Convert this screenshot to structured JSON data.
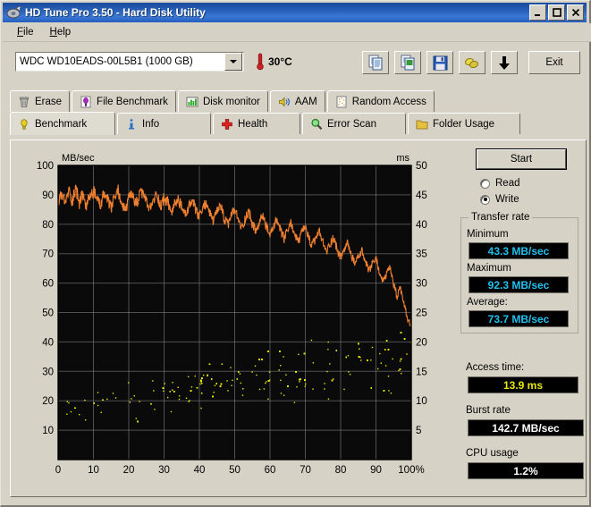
{
  "window": {
    "title": "HD Tune Pro 3.50 - Hard Disk Utility",
    "icon": "hdtune-icon",
    "minimize": "_",
    "maximize": "□",
    "close": "✕"
  },
  "menu": [
    {
      "label": "File",
      "accel": "F"
    },
    {
      "label": "Help",
      "accel": "H"
    }
  ],
  "toolbar": {
    "drive": "WDC WD10EADS-00L5B1 (1000 GB)",
    "temperature": "30°C",
    "buttons": [
      {
        "name": "copy-button",
        "icon": "copy-icon"
      },
      {
        "name": "copy-image-button",
        "icon": "copy-image-icon"
      },
      {
        "name": "save-button",
        "icon": "floppy-disk-icon"
      },
      {
        "name": "settings-button",
        "icon": "options-icon"
      },
      {
        "name": "download-button",
        "icon": "down-arrow-icon"
      }
    ],
    "exit_label": "Exit"
  },
  "tabs": {
    "back_row": [
      {
        "label": "Erase",
        "icon": "trash-icon"
      },
      {
        "label": "File Benchmark",
        "icon": "file-benchmark-icon"
      },
      {
        "label": "Disk monitor",
        "icon": "disk-monitor-icon"
      },
      {
        "label": "AAM",
        "icon": "speaker-icon"
      },
      {
        "label": "Random Access",
        "icon": "random-access-icon"
      }
    ],
    "front_row": [
      {
        "label": "Benchmark",
        "icon": "bulb-icon",
        "active": true
      },
      {
        "label": "Info",
        "icon": "info-icon",
        "active": false
      },
      {
        "label": "Health",
        "icon": "health-cross-icon",
        "active": false
      },
      {
        "label": "Error Scan",
        "icon": "magnifier-icon",
        "active": false
      },
      {
        "label": "Folder Usage",
        "icon": "folder-icon",
        "active": false
      }
    ]
  },
  "controls": {
    "start_label": "Start",
    "mode_read": "Read",
    "mode_write": "Write",
    "selected_mode": "Write"
  },
  "results": {
    "transfer_rate_group": "Transfer rate",
    "minimum_label": "Minimum",
    "minimum_value": "43.3 MB/sec",
    "maximum_label": "Maximum",
    "maximum_value": "92.3 MB/sec",
    "average_label": "Average:",
    "average_value": "73.7 MB/sec",
    "access_time_label": "Access time:",
    "access_time_value": "13.9 ms",
    "burst_rate_label": "Burst rate",
    "burst_rate_value": "142.7 MB/sec",
    "cpu_usage_label": "CPU usage",
    "cpu_usage_value": "1.2%"
  },
  "colors": {
    "transfer_curve": "#f08030",
    "access_dots": "#e8e800",
    "grid": "#8a8a8a",
    "plot_bg": "#0a0a0a",
    "lcd_cyan": "#22c0ee",
    "lcd_yellow": "#e8e800",
    "titlebar": "#2a63bd"
  },
  "chart_data": {
    "type": "line",
    "title": "",
    "xlabel": "",
    "ylabel": "MB/sec",
    "y2label": "ms",
    "xlim": [
      0,
      100
    ],
    "ylim": [
      0,
      100
    ],
    "y2lim": [
      0,
      50
    ],
    "grid": true,
    "xticks": [
      0,
      10,
      20,
      30,
      40,
      50,
      60,
      70,
      80,
      90,
      100
    ],
    "xticklabels": [
      "0",
      "10",
      "20",
      "30",
      "40",
      "50",
      "60",
      "70",
      "80",
      "90",
      "100%"
    ],
    "yticks": [
      10,
      20,
      30,
      40,
      50,
      60,
      70,
      80,
      90,
      100
    ],
    "y2ticks": [
      5,
      10,
      15,
      20,
      25,
      30,
      35,
      40,
      45,
      50
    ],
    "series": [
      {
        "name": "Transfer rate",
        "type": "line",
        "color": "#f08030",
        "axis": "left",
        "unit": "MB/sec",
        "x": [
          0,
          1,
          2,
          3,
          4,
          5,
          6,
          7,
          8,
          9,
          10,
          11,
          12,
          13,
          14,
          15,
          16,
          17,
          18,
          19,
          20,
          21,
          22,
          23,
          24,
          25,
          26,
          27,
          28,
          29,
          30,
          31,
          32,
          33,
          34,
          35,
          36,
          37,
          38,
          39,
          40,
          41,
          42,
          43,
          44,
          45,
          46,
          47,
          48,
          49,
          50,
          51,
          52,
          53,
          54,
          55,
          56,
          57,
          58,
          59,
          60,
          61,
          62,
          63,
          64,
          65,
          66,
          67,
          68,
          69,
          70,
          71,
          72,
          73,
          74,
          75,
          76,
          77,
          78,
          79,
          80,
          81,
          82,
          83,
          84,
          85,
          86,
          87,
          88,
          89,
          90,
          91,
          92,
          93,
          94,
          95,
          96,
          97,
          98,
          99,
          100
        ],
        "y": [
          86.5,
          90.5,
          87.0,
          91.5,
          88.0,
          92.3,
          87.5,
          90.0,
          86.0,
          89.5,
          91.0,
          88.5,
          86.5,
          90.5,
          88.0,
          85.5,
          89.0,
          91.5,
          87.0,
          84.5,
          88.5,
          90.0,
          86.5,
          89.5,
          91.0,
          87.5,
          85.0,
          88.0,
          90.5,
          86.0,
          89.0,
          87.5,
          84.0,
          86.5,
          88.5,
          85.5,
          83.0,
          86.0,
          88.0,
          84.5,
          82.5,
          85.5,
          87.5,
          83.5,
          81.0,
          84.0,
          86.5,
          82.0,
          79.5,
          83.0,
          85.0,
          81.5,
          78.5,
          82.0,
          84.5,
          80.0,
          77.5,
          80.5,
          83.0,
          79.0,
          76.0,
          79.5,
          81.5,
          77.5,
          75.0,
          78.0,
          80.5,
          76.5,
          74.0,
          77.0,
          79.0,
          75.0,
          72.5,
          75.5,
          77.5,
          73.5,
          70.5,
          73.5,
          75.5,
          71.5,
          68.5,
          71.5,
          73.5,
          69.5,
          66.5,
          69.0,
          71.0,
          67.0,
          64.0,
          66.5,
          68.5,
          63.5,
          60.5,
          63.0,
          65.0,
          59.5,
          55.5,
          58.0,
          52.5,
          47.5,
          45.0
        ]
      },
      {
        "name": "Access time",
        "type": "scatter",
        "color": "#e8e800",
        "axis": "right",
        "unit": "ms",
        "description": "Dense scatter of access-time samples rising from about 4 ms near 0% to about 22 ms near 100%, with heaviest density between 8 ms and 17 ms",
        "x_range": [
          0,
          100
        ],
        "y_range": [
          3.5,
          22.5
        ],
        "trend_start_ms": 9.0,
        "trend_end_ms": 17.5,
        "spread_ms": 6.0,
        "point_count": 1600
      }
    ]
  }
}
